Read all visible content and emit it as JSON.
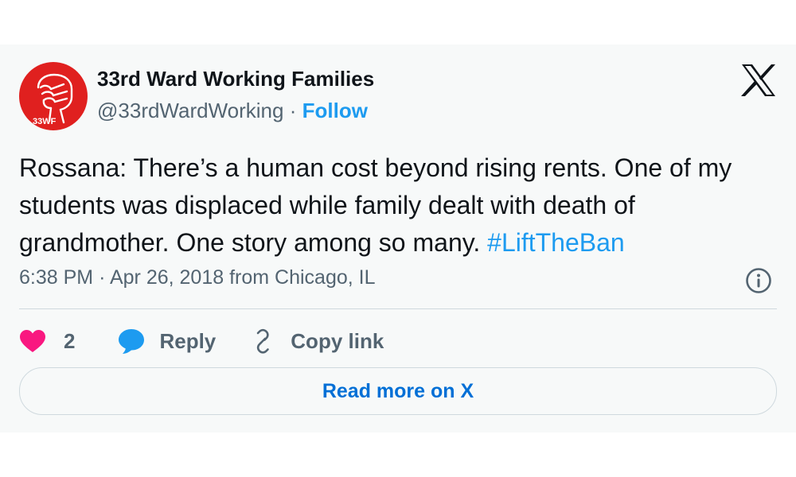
{
  "author": {
    "name": "33rd Ward Working Families",
    "handle": "@33rdWardWorking",
    "separator": "·",
    "follow_label": "Follow",
    "avatar_text": "33WF"
  },
  "tweet": {
    "text": "Rossana: There’s a human cost beyond rising rents. One of my students was displaced while family dealt with death of grandmother. One story among so many. ",
    "hashtag": "#LiftTheBan"
  },
  "meta": {
    "time": "6:38 PM",
    "separator": "·",
    "date_location": "Apr 26, 2018 from Chicago, IL"
  },
  "actions": {
    "like_count": "2",
    "reply_label": "Reply",
    "copy_link_label": "Copy link"
  },
  "read_more_label": "Read more on X",
  "colors": {
    "avatar_bg": "#e0201f",
    "link": "#1d9bf0",
    "heart": "#f91880",
    "reply_icon": "#1d9bf0",
    "read_more_text": "#006fd6"
  },
  "icons": {
    "platform_logo": "x-logo-icon",
    "like": "heart-icon",
    "reply": "speech-bubble-icon",
    "copy": "link-icon",
    "info": "info-icon"
  }
}
